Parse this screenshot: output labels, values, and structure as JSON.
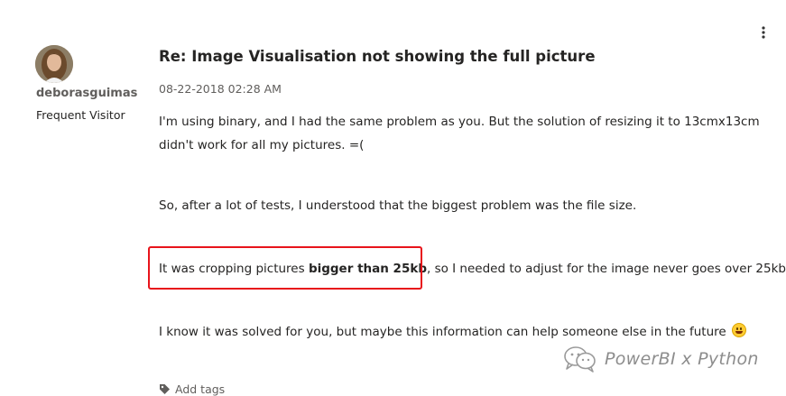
{
  "post": {
    "author": "deborasguimas",
    "rank": "Frequent Visitor",
    "title": "Re: Image Visualisation not showing the full picture",
    "date": "08-22-2018 02:28 AM",
    "body": {
      "p1_line1": "I'm using binary, and I had the same problem as you. But the solution of resizing it to 13cmx13cm",
      "p1_line2": "didn't work for all my pictures. =(",
      "p2": "So, after a lot of tests, I understood that the biggest problem was the file size.",
      "p3_before": "It was cropping pictures ",
      "p3_bold": "bigger than 25kb",
      "p3_after": ", so I needed to adjust for the image never goes over 25kb.",
      "p4": "I know it was solved for you, but maybe this information can help someone else in the future"
    },
    "add_tags_label": "Add tags"
  },
  "watermark": {
    "text": "PowerBI x Python"
  },
  "colors": {
    "highlight_border": "#e8141b",
    "text_primary": "#252423",
    "text_secondary": "#605e5c",
    "watermark": "#8d8d8d"
  },
  "icons": {
    "menu": "kebab-menu-icon",
    "avatar": "avatar",
    "tag": "tag-icon",
    "emoji": "grinning-face-emoji",
    "watermark": "wechat-icon"
  }
}
